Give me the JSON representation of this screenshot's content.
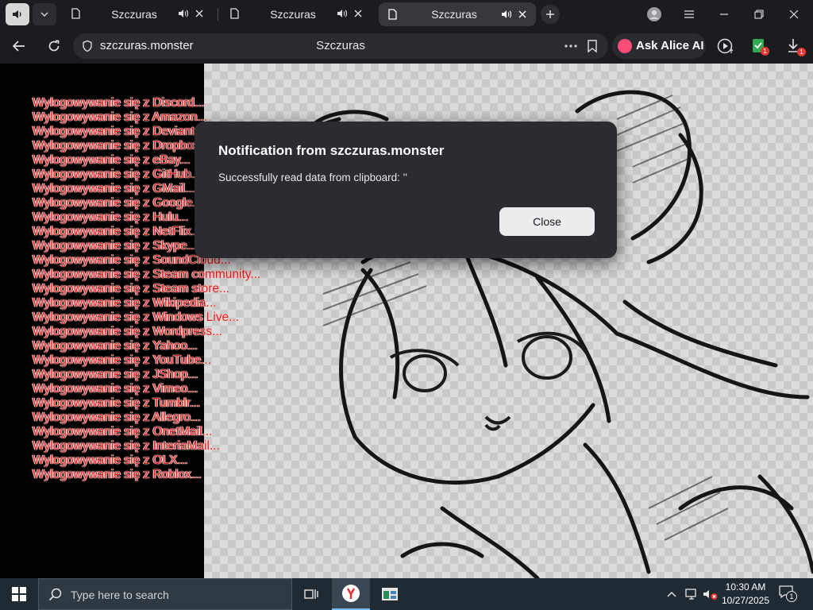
{
  "browser": {
    "tabs": [
      {
        "title": "Szczuras",
        "active": false
      },
      {
        "title": "Szczuras",
        "active": false
      },
      {
        "title": "Szczuras",
        "active": true
      }
    ],
    "url": "szczuras.monster",
    "page_title": "Szczuras",
    "alice_label": "Ask Alice AI",
    "badge_extension": "1",
    "badge_downloads": "1"
  },
  "page": {
    "log_lines": [
      "Wylogowywanie się z Discord...",
      "Wylogowywanie się z Amazon...",
      "Wylogowywanie się z DeviantArt...",
      "Wylogowywanie się z Dropbox...",
      "Wylogowywanie się z eBay...",
      "Wylogowywanie się z GitHub...",
      "Wylogowywanie się z GMail...",
      "Wylogowywanie się z Google...",
      "Wylogowywanie się z Hulu...",
      "Wylogowywanie się z NetFlix...",
      "Wylogowywanie się z Skype...",
      "Wylogowywanie się z SoundCloud...",
      "Wylogowywanie się z Steam community...",
      "Wylogowywanie się z Steam store...",
      "Wylogowywanie się z Wikipedia...",
      "Wylogowywanie się z Windows Live...",
      "Wylogowywanie się z Wordpress...",
      "Wylogowywanie się z Yahoo...",
      "Wylogowywanie się z YouTube...",
      "Wylogowywanie się z JShop...",
      "Wylogowywanie się z Vimeo...",
      "Wylogowywanie się z Tumblr...",
      "Wylogowywanie się z Allegro...",
      "Wylogowywanie się z OnetMail...",
      "Wylogowywanie się z InteriaMail...",
      "Wylogowywanie się z OLX...",
      "Wylogowywanie się z Roblox..."
    ]
  },
  "dialog": {
    "title": "Notification from szczuras.monster",
    "message": "Successfully read data from clipboard: ''",
    "close_label": "Close"
  },
  "taskbar": {
    "search_placeholder": "Type here to search",
    "time": "10:30 AM",
    "date": "10/27/2025",
    "notification_count": "1"
  },
  "colors": {
    "log_text": "#d41f1f",
    "tabstrip_bg": "#1b1c20",
    "dialog_bg": "#2b2b30",
    "taskbar_bg": "#202a33",
    "alice_accent": "#ff4d7a"
  }
}
